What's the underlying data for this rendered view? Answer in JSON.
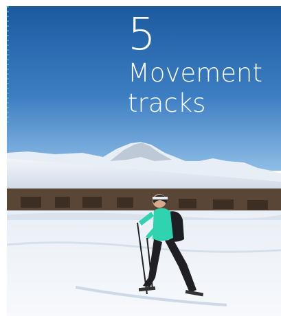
{
  "hero": {
    "number": "5",
    "title_line1": "Movement",
    "title_line2": "tracks",
    "image_description_icon": "snowshoe-hiker-photo"
  },
  "colors": {
    "sky_top": "#1f5ea3",
    "sky_bottom": "#7eb3e0",
    "snow": "#f4f7fb",
    "accent_dots": "#3fd19c",
    "jacket": "#2fd3b0"
  }
}
